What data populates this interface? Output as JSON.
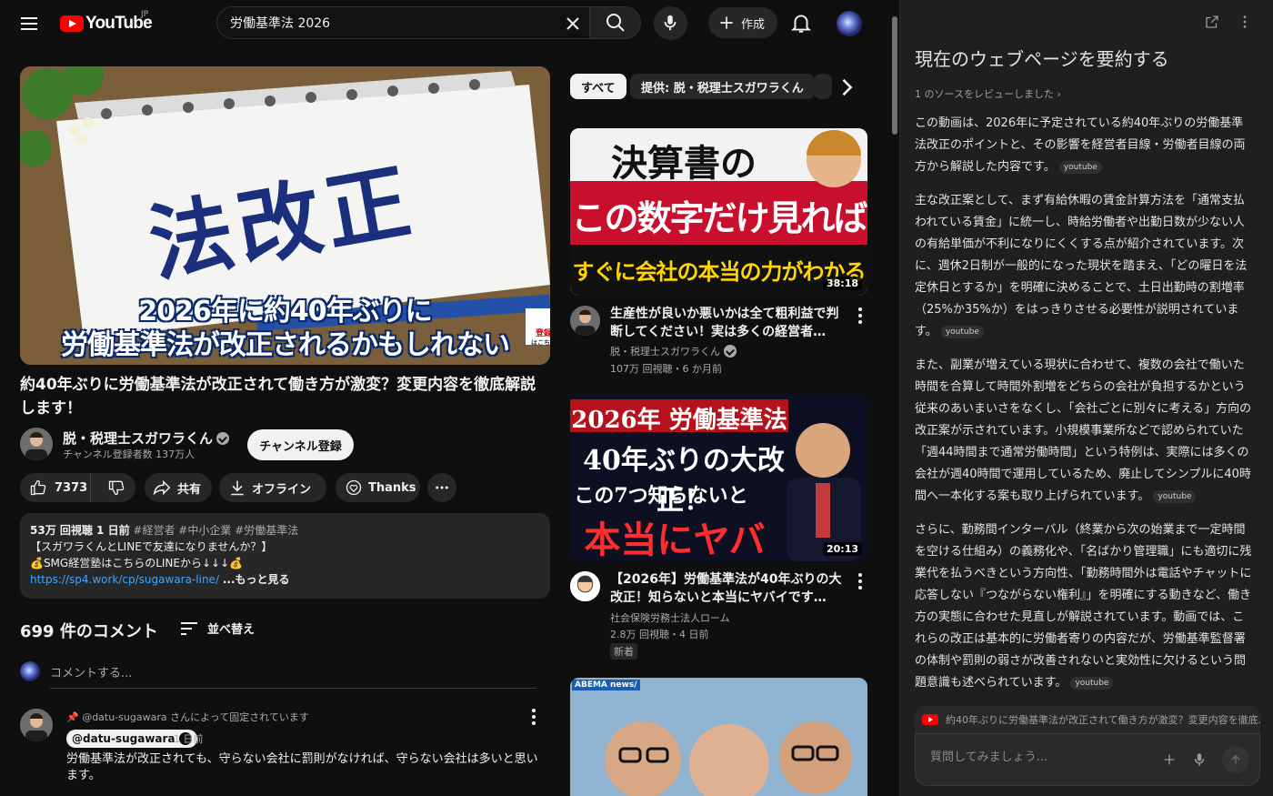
{
  "topbar": {
    "logo_text": "YouTube",
    "region": "JP",
    "search_value": "労働基準法 2026",
    "create_label": "作成"
  },
  "video": {
    "thumb_main": "法改正",
    "caption_line1": "2026年に約40年ぶりに",
    "caption_line2": "労働基準法が改正されるかもしれない",
    "thumb_badge_line1": "登録",
    "thumb_badge_line2": "はこちら",
    "title": "約40年ぶりに労働基準法が改正されて働き方が激変？変更内容を徹底解説します！",
    "channel_name": "脱・税理士スガワラくん",
    "subscribers": "チャンネル登録者数 137万人",
    "subscribe_label": "チャンネル登録",
    "likes": "7373",
    "share_label": "共有",
    "offline_label": "オフライン",
    "thanks_label": "Thanks"
  },
  "description": {
    "meta": "53万 回視聴  1 日前",
    "tags": "#経営者 #中小企業 #労働基準法",
    "line1": "【スガワラくんとLINEで友達になりませんか？】",
    "line2": "💰SMG経営塾はこちらのLINEから↓↓↓💰",
    "link": "https://sp4.work/cp/sugawara-line/",
    "more": "...もっと見る"
  },
  "comments": {
    "count_label": "699 件のコメント",
    "sort_label": "並べ替え",
    "input_placeholder": "コメントする...",
    "pinned_by": "@datu-sugawara さんによって固定されています",
    "author": "@datu-sugawara",
    "time": "1 日前",
    "text": "労働基準法が改正されても、守らない会社に罰則がなければ、守らない会社は多いと思います。"
  },
  "chips": [
    "すべて",
    "提供: 脱・税理士スガワラくん"
  ],
  "recommendations": [
    {
      "thumb_line1": "決算書の",
      "thumb_line2": "この数字だけ見れば",
      "thumb_line3": "すぐに会社の本当の力がわかる",
      "duration": "38:18",
      "title": "生産性が良いか悪いかは全て粗利益で判断してください！実は多くの経営者…",
      "channel": "脱・税理士スガワラくん",
      "stats": "107万 回視聴・6 か月前"
    },
    {
      "thumb_line1": "2026年 労働基準法",
      "thumb_line2": "40年ぶりの大改正！",
      "thumb_line3": "この7つ知らないと",
      "thumb_line4": "本当にヤバイ",
      "duration": "20:13",
      "title": "【2026年】労働基準法が40年ぶりの大改正！知らないと本当にヤバイです…",
      "channel": "社会保険労務士法人ローム",
      "stats": "2.8万 回視聴・4 日前",
      "badge": "新着"
    },
    {
      "thumb_brand": "ABEMA news/"
    }
  ],
  "panel": {
    "title": "現在のウェブページを要約する",
    "sources": "1 のソースをレビューしました",
    "p1": "この動画は、2026年に予定されている約40年ぶりの労働基準法改正のポイントと、その影響を経営者目線・労働者目線の両方から解説した内容です。",
    "p2": "主な改正案として、まず有給休暇の賃金計算方法を「通常支払われている賃金」に統一し、時給労働者や出勤日数が少ない人の有給単価が不利になりにくくする点が紹介されています。次に、週休2日制が一般的になった現状を踏まえ、「どの曜日を法定休日とするか」を明確に決めることで、土日出勤時の割増率（25%か35%か）をはっきりさせる必要性が説明されています。",
    "p3": "また、副業が増えている現状に合わせて、複数の会社で働いた時間を合算して時間外割増をどちらの会社が負担するかという従来のあいまいさをなくし、「会社ごとに別々に考える」方向の改正案が示されています。小規模事業所などで認められていた「週44時間まで通常労働時間」という特例は、実際には多くの会社が週40時間で運用しているため、廃止してシンプルに40時間へ一本化する案も取り上げられています。",
    "p4": "さらに、勤務間インターバル（終業から次の始業まで一定時間を空ける仕組み）の義務化や、「名ばかり管理職」にも適切に残業代を払うべきという方向性、「勤務時間外は電話やチャットに応答しない『つながらない権利』」を明確にする動きなど、働き方の実態に合わせた見直しが解説されています。動画では、これらの改正は基本的に労働者寄りの内容だが、労働基準監督署の体制や罰則の弱さが改善されないと実効性に欠けるという問題意識も述べられています。",
    "source_chip": "youtube",
    "source_card": "約40年ぶりに労働基準法が改正されて働き方が激変？変更内容を徹底...",
    "ask_placeholder": "質問してみましょう..."
  },
  "colors": {
    "background": "#0f0f0f",
    "panel_bg": "#1f1f1f",
    "accent_red": "#ff0000",
    "link_blue": "#3ea6ff"
  }
}
